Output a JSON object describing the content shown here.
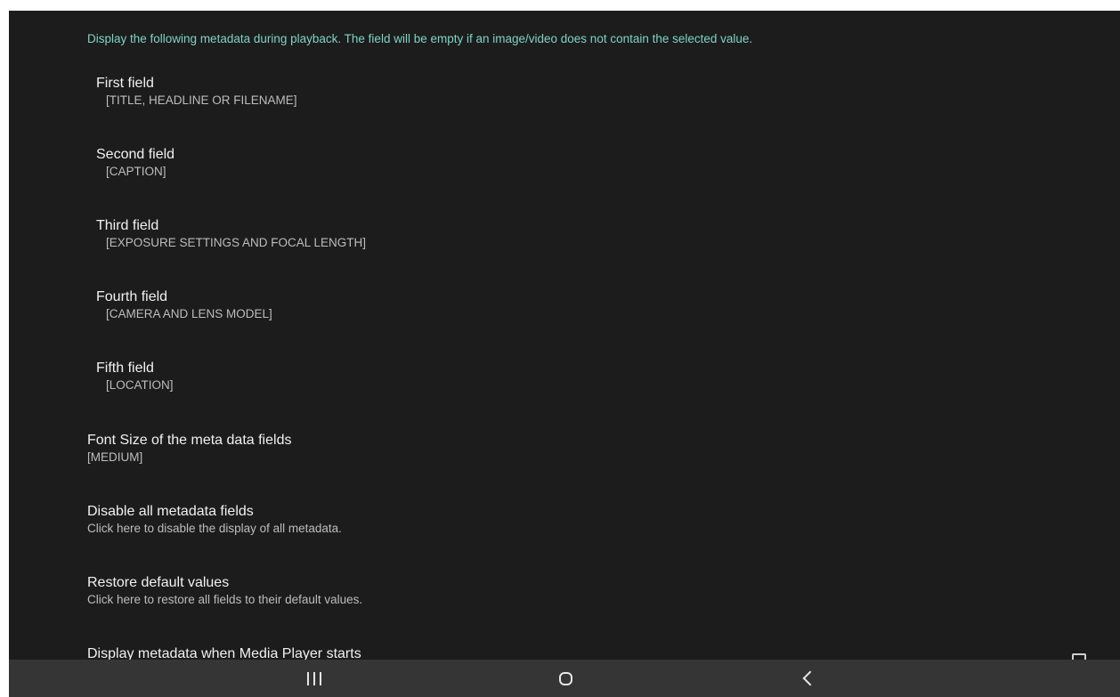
{
  "intro_text": "Display the following metadata during playback. The field will be empty if an image/video does not contain the selected value.",
  "preferences": [
    {
      "title": "First field",
      "summary": "[TITLE, HEADLINE OR FILENAME]"
    },
    {
      "title": "Second field",
      "summary": "[CAPTION]"
    },
    {
      "title": "Third field",
      "summary": "[EXPOSURE SETTINGS AND FOCAL LENGTH]"
    },
    {
      "title": "Fourth field",
      "summary": "[CAMERA AND LENS MODEL]"
    },
    {
      "title": "Fifth field",
      "summary": "[LOCATION]"
    },
    {
      "title": "Font Size of the meta data fields",
      "summary": "[MEDIUM]"
    },
    {
      "title": "Disable all metadata fields",
      "summary": "Click here to disable the display of all metadata."
    },
    {
      "title": "Restore default values",
      "summary": "Click here to restore all fields to their default values."
    },
    {
      "title": "Display metadata when Media Player starts",
      "summary": ""
    }
  ],
  "navbar": {
    "recents_icon": "recents-icon",
    "home_icon": "home-icon",
    "back_icon": "back-icon"
  },
  "colors": {
    "background": "#1c1c1c",
    "accent": "#7fd3c2",
    "navbar": "#353535"
  }
}
